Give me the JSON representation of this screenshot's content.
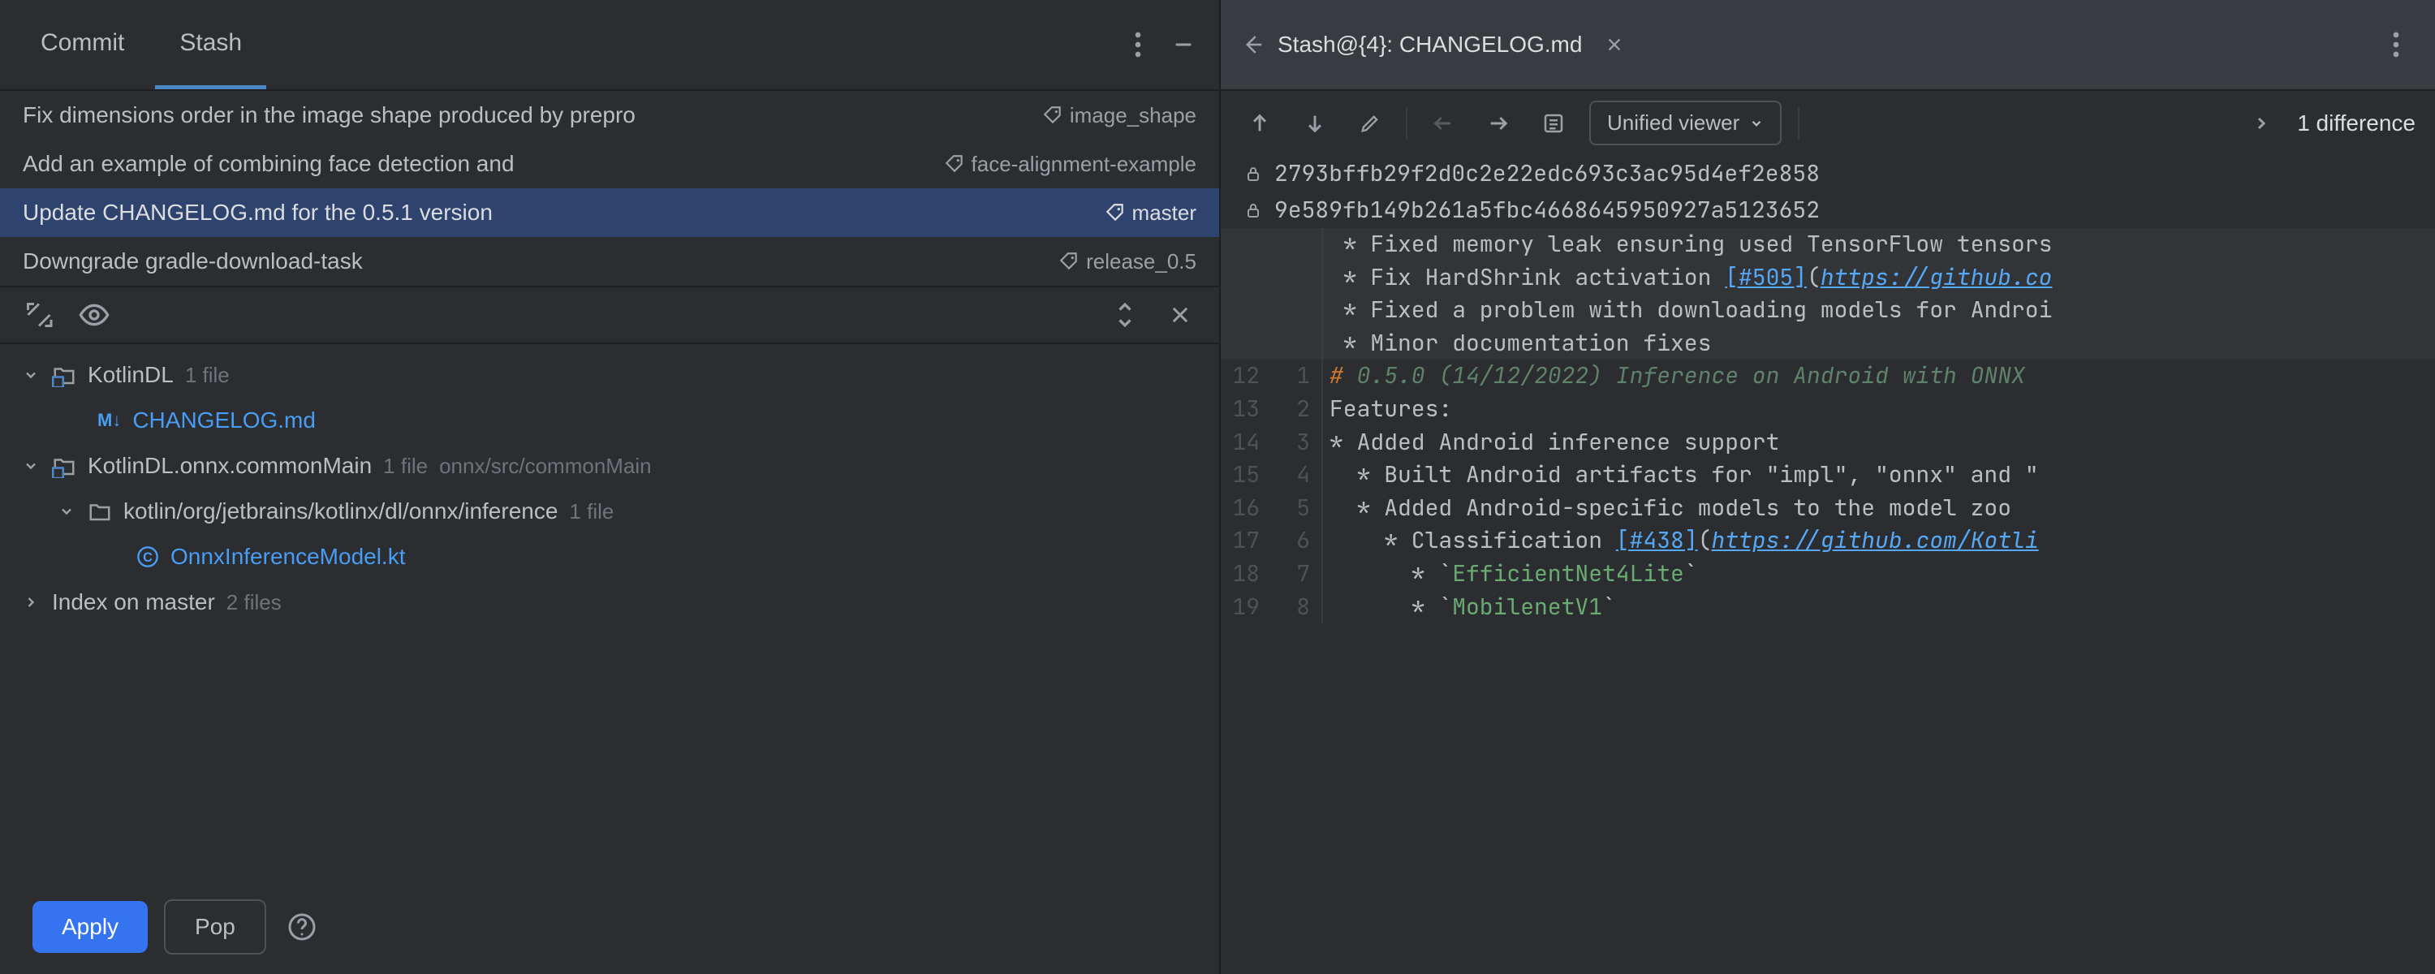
{
  "tabs": {
    "commit": "Commit",
    "stash": "Stash"
  },
  "commits": [
    {
      "msg": "Fix dimensions order in the image shape produced by prepro",
      "tag": "image_shape"
    },
    {
      "msg": "Add an example of combining face detection and ",
      "tag": "face-alignment-example"
    },
    {
      "msg": "Update CHANGELOG.md for the 0.5.1 version",
      "tag": "master"
    },
    {
      "msg": "Downgrade gradle-download-task",
      "tag": "release_0.5"
    }
  ],
  "tree": {
    "node0": {
      "name": "KotlinDL",
      "count": "1 file"
    },
    "node0_file": "CHANGELOG.md",
    "node1": {
      "name": "KotlinDL.onnx.commonMain",
      "count": "1 file",
      "path": "onnx/src/commonMain"
    },
    "node1_sub": {
      "name": "kotlin/org/jetbrains/kotlinx/dl/onnx/inference",
      "count": "1 file"
    },
    "node1_file": "OnnxInferenceModel.kt",
    "node2": {
      "name": "Index on master",
      "count": "2 files"
    }
  },
  "footer": {
    "apply": "Apply",
    "pop": "Pop"
  },
  "right": {
    "title": "Stash@{4}: CHANGELOG.md",
    "viewer": "Unified viewer",
    "diffcount": "1 difference",
    "hash1": "2793bffb29f2d0c2e22edc693c3ac95d4ef2e858",
    "hash2": "9e589fb149b261a5fbc4668645950927a5123652"
  },
  "diff": {
    "ctx": [
      {
        "t": " * Fixed memory leak ensuring used TensorFlow tensors"
      },
      {
        "pre": " * Fix HardShrink activation ",
        "link1": "[#505]",
        "mid": "(",
        "link2": "https://github.co"
      },
      {
        "t": " * Fixed a problem with downloading models for Androi"
      },
      {
        "t": " * Minor documentation fixes"
      },
      {
        "t": ""
      }
    ],
    "lines": [
      {
        "a": "12",
        "b": "1",
        "cls": "hdr",
        "pre": "# ",
        "ital": "0.5.0 (14/12/2022) Inference on Android with ONNX"
      },
      {
        "a": "13",
        "b": "2",
        "t": "Features:"
      },
      {
        "a": "14",
        "b": "3",
        "t": "* Added Android inference support"
      },
      {
        "a": "15",
        "b": "4",
        "t": "  * Built Android artifacts for \"impl\", \"onnx\" and \""
      },
      {
        "a": "16",
        "b": "5",
        "t": "  * Added Android-specific models to the model zoo"
      },
      {
        "a": "17",
        "b": "6",
        "pre": "    * Classification ",
        "link1": "[#438]",
        "mid": "(",
        "link2": "https://github.com/Kotli"
      },
      {
        "a": "18",
        "b": "7",
        "pre": "      * `",
        "code": "EfficientNet4Lite",
        "post": "`"
      },
      {
        "a": "19",
        "b": "8",
        "pre": "      * `",
        "code": "MobilenetV1",
        "post": "`"
      }
    ]
  }
}
